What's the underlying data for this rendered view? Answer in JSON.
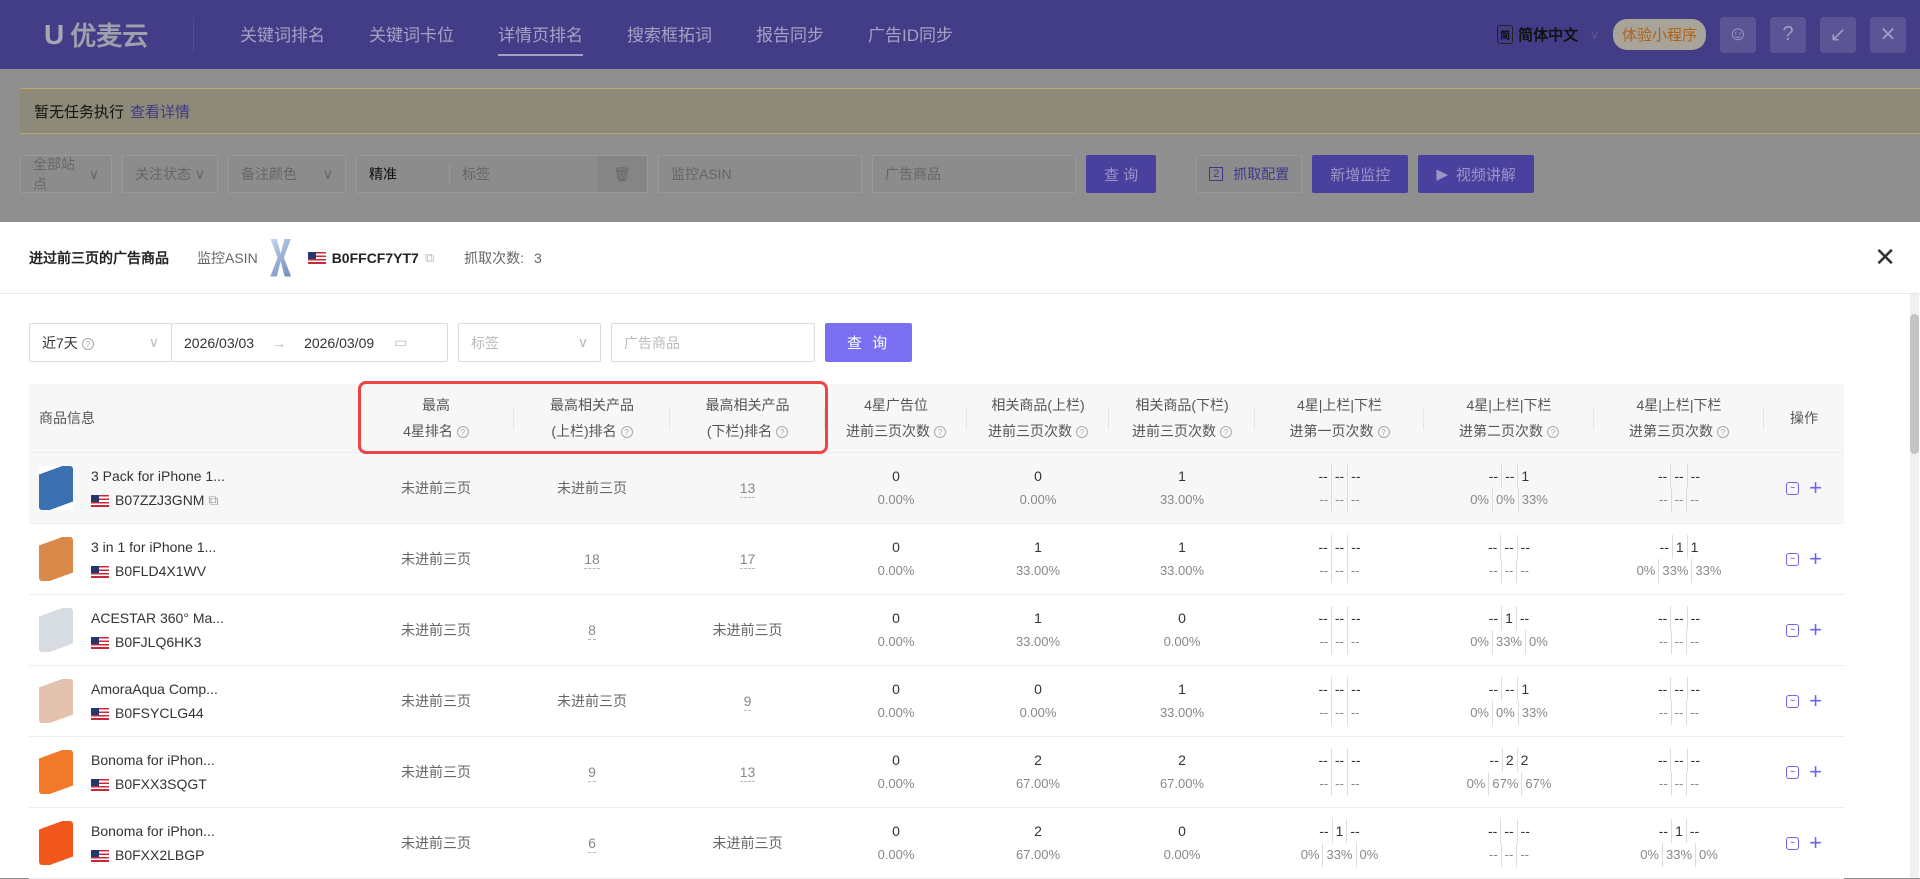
{
  "app": {
    "logo": "优麦云",
    "nav": [
      "关键词排名",
      "关键词卡位",
      "详情页排名",
      "搜索框拓词",
      "报告同步",
      "广告ID同步"
    ],
    "active_nav": 2,
    "lang_icon": "简",
    "lang": "简体中文",
    "mini_program": "体验小程序"
  },
  "notice": {
    "text": "暂无任务执行",
    "link": "查看详情"
  },
  "bg_filters": {
    "site": "全部站点",
    "follow": "关注状态",
    "color": "备注颜色",
    "match": "精准",
    "tag": "标签",
    "asin_ph": "监控ASIN",
    "ad_ph": "广告商品",
    "query": "查 询",
    "config_num": "2",
    "config": "抓取配置",
    "add": "新增监控",
    "video": "视频讲解"
  },
  "modal": {
    "title": "进过前三页的广告商品",
    "asin_label": "监控ASIN",
    "asin": "B0FFCF7YT7",
    "count_label": "抓取次数:",
    "count": "3",
    "filters": {
      "range": "近7天",
      "date_from": "2026/03/03",
      "date_to": "2026/03/09",
      "tag_ph": "标签",
      "ad_ph": "广告商品",
      "query": "查 询"
    }
  },
  "table": {
    "headers": [
      [
        "商品信息"
      ],
      [
        "最高",
        "4星排名"
      ],
      [
        "最高相关产品",
        "(上栏)排名"
      ],
      [
        "最高相关产品",
        "(下栏)排名"
      ],
      [
        "4星广告位",
        "进前三页次数"
      ],
      [
        "相关商品(上栏)",
        "进前三页次数"
      ],
      [
        "相关商品(下栏)",
        "进前三页次数"
      ],
      [
        "4星|上栏|下栏",
        "进第一页次数"
      ],
      [
        "4星|上栏|下栏",
        "进第二页次数"
      ],
      [
        "4星|上栏|下栏",
        "进第三页次数"
      ],
      [
        "操作"
      ]
    ],
    "rows": [
      {
        "name": "3 Pack for iPhone 1...",
        "asin": "B07ZZJ3GNM",
        "img": "#3a6fb0",
        "r4": "未进前三页",
        "rup": "未进前三页",
        "rdn": "13",
        "c4": [
          "0",
          "0.00%"
        ],
        "cup": [
          "0",
          "0.00%"
        ],
        "cdn": [
          "1",
          "33.00%"
        ],
        "p1": [
          [
            "--",
            "--",
            "--"
          ],
          [
            "--",
            "--",
            "--"
          ]
        ],
        "p2": [
          [
            "--",
            "--",
            "1"
          ],
          [
            "0%",
            "0%",
            "33%"
          ]
        ],
        "p3": [
          [
            "--",
            "--",
            "--"
          ],
          [
            "--",
            "--",
            "--"
          ]
        ]
      },
      {
        "name": "3 in 1 for iPhone 1...",
        "asin": "B0FLD4X1WV",
        "img": "#d98a4a",
        "r4": "未进前三页",
        "rup": "18",
        "rdn": "17",
        "c4": [
          "0",
          "0.00%"
        ],
        "cup": [
          "1",
          "33.00%"
        ],
        "cdn": [
          "1",
          "33.00%"
        ],
        "p1": [
          [
            "--",
            "--",
            "--"
          ],
          [
            "--",
            "--",
            "--"
          ]
        ],
        "p2": [
          [
            "--",
            "--",
            "--"
          ],
          [
            "--",
            "--",
            "--"
          ]
        ],
        "p3": [
          [
            "--",
            "1",
            "1"
          ],
          [
            "0%",
            "33%",
            "33%"
          ]
        ]
      },
      {
        "name": "ACESTAR 360° Ma...",
        "asin": "B0FJLQ6HK3",
        "img": "#d7dbe2",
        "r4": "未进前三页",
        "rup": "8",
        "rdn": "未进前三页",
        "c4": [
          "0",
          "0.00%"
        ],
        "cup": [
          "1",
          "33.00%"
        ],
        "cdn": [
          "0",
          "0.00%"
        ],
        "p1": [
          [
            "--",
            "--",
            "--"
          ],
          [
            "--",
            "--",
            "--"
          ]
        ],
        "p2": [
          [
            "--",
            "1",
            "--"
          ],
          [
            "0%",
            "33%",
            "0%"
          ]
        ],
        "p3": [
          [
            "--",
            "--",
            "--"
          ],
          [
            "--",
            "--",
            "--"
          ]
        ]
      },
      {
        "name": "AmoraAqua Comp...",
        "asin": "B0FSYCLG44",
        "img": "#e3c2ae",
        "r4": "未进前三页",
        "rup": "未进前三页",
        "rdn": "9",
        "c4": [
          "0",
          "0.00%"
        ],
        "cup": [
          "0",
          "0.00%"
        ],
        "cdn": [
          "1",
          "33.00%"
        ],
        "p1": [
          [
            "--",
            "--",
            "--"
          ],
          [
            "--",
            "--",
            "--"
          ]
        ],
        "p2": [
          [
            "--",
            "--",
            "1"
          ],
          [
            "0%",
            "0%",
            "33%"
          ]
        ],
        "p3": [
          [
            "--",
            "--",
            "--"
          ],
          [
            "--",
            "--",
            "--"
          ]
        ]
      },
      {
        "name": "Bonoma for iPhon...",
        "asin": "B0FXX3SQGT",
        "img": "#f07a2a",
        "r4": "未进前三页",
        "rup": "9",
        "rdn": "13",
        "c4": [
          "0",
          "0.00%"
        ],
        "cup": [
          "2",
          "67.00%"
        ],
        "cdn": [
          "2",
          "67.00%"
        ],
        "p1": [
          [
            "--",
            "--",
            "--"
          ],
          [
            "--",
            "--",
            "--"
          ]
        ],
        "p2": [
          [
            "--",
            "2",
            "2"
          ],
          [
            "0%",
            "67%",
            "67%"
          ]
        ],
        "p3": [
          [
            "--",
            "--",
            "--"
          ],
          [
            "--",
            "--",
            "--"
          ]
        ]
      },
      {
        "name": "Bonoma for iPhon...",
        "asin": "B0FXX2LBGP",
        "img": "#f2581c",
        "r4": "未进前三页",
        "rup": "6",
        "rdn": "未进前三页",
        "c4": [
          "0",
          "0.00%"
        ],
        "cup": [
          "2",
          "67.00%"
        ],
        "cdn": [
          "0",
          "0.00%"
        ],
        "p1": [
          [
            "--",
            "1",
            "--"
          ],
          [
            "0%",
            "33%",
            "0%"
          ]
        ],
        "p2": [
          [
            "--",
            "--",
            "--"
          ],
          [
            "--",
            "--",
            "--"
          ]
        ],
        "p3": [
          [
            "--",
            "1",
            "--"
          ],
          [
            "0%",
            "33%",
            "0%"
          ]
        ]
      }
    ]
  }
}
